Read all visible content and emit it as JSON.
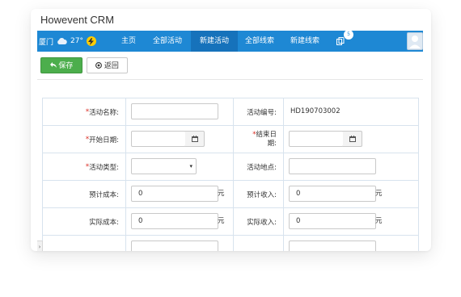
{
  "app": {
    "title": "Howevent CRM"
  },
  "navbar": {
    "city": "厦门",
    "temperature": "27°",
    "weather_icon": "cloud-icon",
    "items": [
      {
        "label": "主页",
        "active": false
      },
      {
        "label": "全部活动",
        "active": false
      },
      {
        "label": "新建活动",
        "active": true
      },
      {
        "label": "全部线索",
        "active": false
      },
      {
        "label": "新建线索",
        "active": false
      }
    ],
    "notification_count": "5",
    "colors": {
      "bar": "#1e88d4",
      "active": "#1672bb"
    }
  },
  "toolbar": {
    "save_label": "保存",
    "back_label": "返回",
    "colors": {
      "save": "#4cae4c"
    }
  },
  "form": {
    "name_label": "活动名称:",
    "name_value": "",
    "number_label": "活动编号:",
    "number_value": "HD190703002",
    "start_label": "开始日期:",
    "start_value": "",
    "end_label": "结束日期:",
    "end_value": "",
    "type_label": "活动类型:",
    "type_value": "",
    "location_label": "活动地点:",
    "location_value": "",
    "est_cost_label": "预计成本:",
    "est_cost_value": "0",
    "est_income_label": "预计收入:",
    "est_income_value": "0",
    "act_cost_label": "实际成本:",
    "act_cost_value": "0",
    "act_income_label": "实际收入:",
    "act_income_value": "0",
    "unit": "元",
    "required_mark": "*"
  }
}
